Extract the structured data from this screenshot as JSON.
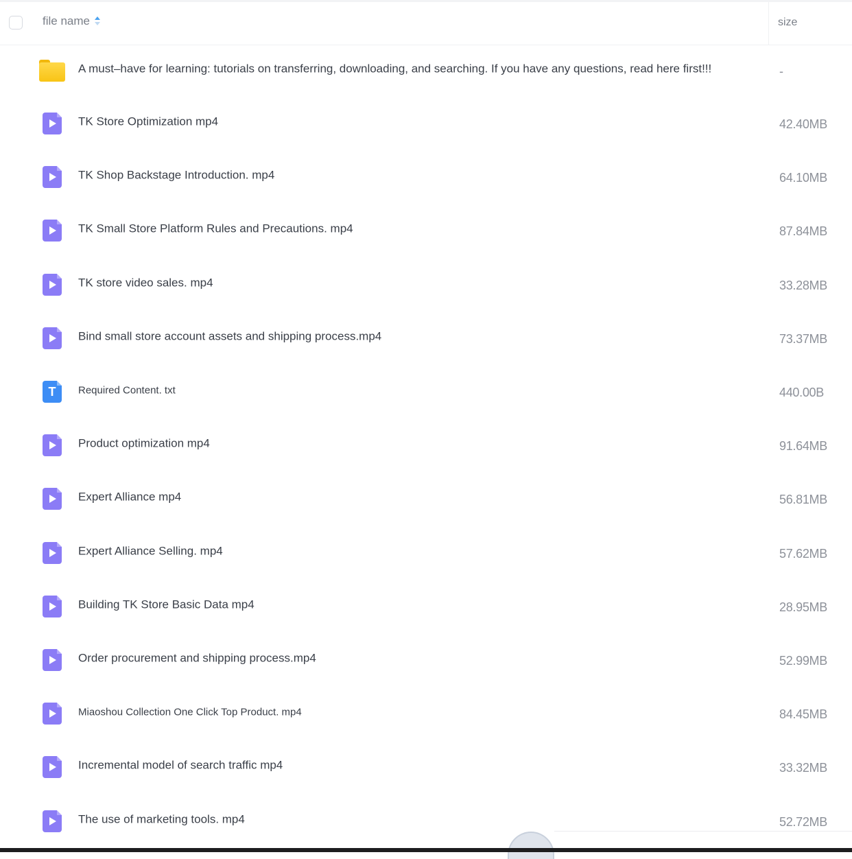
{
  "header": {
    "file_name_label": "file name",
    "size_label": "size"
  },
  "files": [
    {
      "type": "folder",
      "icon": "folder-icon",
      "name": "A must–have for learning: tutorials on transferring, downloading, and searching. If you have any questions, read here first!!!",
      "size": "-"
    },
    {
      "type": "video",
      "icon": "video-file-icon",
      "name": "TK Store Optimization mp4",
      "size": "42.40MB"
    },
    {
      "type": "video",
      "icon": "video-file-icon",
      "name": "TK Shop Backstage Introduction. mp4",
      "size": "64.10MB"
    },
    {
      "type": "video",
      "icon": "video-file-icon",
      "name": "TK Small Store Platform Rules and Precautions. mp4",
      "size": "87.84MB"
    },
    {
      "type": "video",
      "icon": "video-file-icon",
      "name": "TK store video sales. mp4",
      "size": "33.28MB"
    },
    {
      "type": "video",
      "icon": "video-file-icon",
      "name": "Bind small store account assets and shipping process.mp4",
      "size": "73.37MB"
    },
    {
      "type": "text",
      "icon": "text-file-icon",
      "name": "Required Content. txt",
      "size": "440.00B"
    },
    {
      "type": "video",
      "icon": "video-file-icon",
      "name": "Product optimization mp4",
      "size": "91.64MB"
    },
    {
      "type": "video",
      "icon": "video-file-icon",
      "name": "Expert Alliance mp4",
      "size": "56.81MB"
    },
    {
      "type": "video",
      "icon": "video-file-icon",
      "name": "Expert Alliance Selling. mp4",
      "size": "57.62MB"
    },
    {
      "type": "video",
      "icon": "video-file-icon",
      "name": "Building TK Store Basic Data mp4",
      "size": "28.95MB"
    },
    {
      "type": "video",
      "icon": "video-file-icon",
      "name": "Order procurement and shipping process.mp4",
      "size": "52.99MB"
    },
    {
      "type": "video",
      "icon": "video-file-icon",
      "name": "Miaoshou Collection One Click Top Product. mp4",
      "size": "84.45MB"
    },
    {
      "type": "video",
      "icon": "video-file-icon",
      "name": "Incremental model of search traffic mp4",
      "size": "33.32MB"
    },
    {
      "type": "video",
      "icon": "video-file-icon",
      "name": "The use of marketing tools. mp4",
      "size": "52.72MB"
    }
  ]
}
